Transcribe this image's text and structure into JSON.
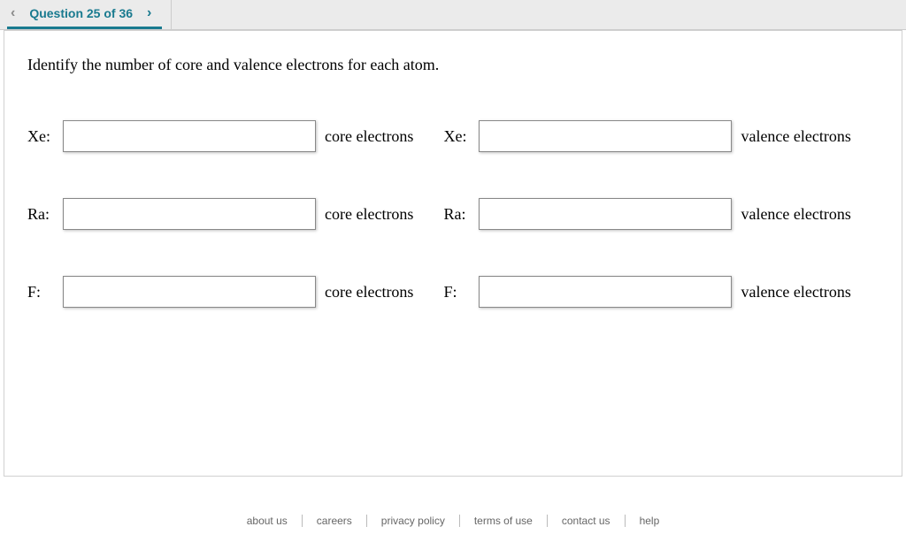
{
  "nav": {
    "title": "Question 25 of 36"
  },
  "prompt": "Identify the number of core and valence electrons for each atom.",
  "labels": {
    "core": "core electrons",
    "valence": "valence electrons"
  },
  "atoms": [
    {
      "name": "Xe:"
    },
    {
      "name": "Ra:"
    },
    {
      "name": "F:"
    }
  ],
  "footer": {
    "about": "about us",
    "careers": "careers",
    "privacy": "privacy policy",
    "terms": "terms of use",
    "contact": "contact us",
    "help": "help"
  }
}
